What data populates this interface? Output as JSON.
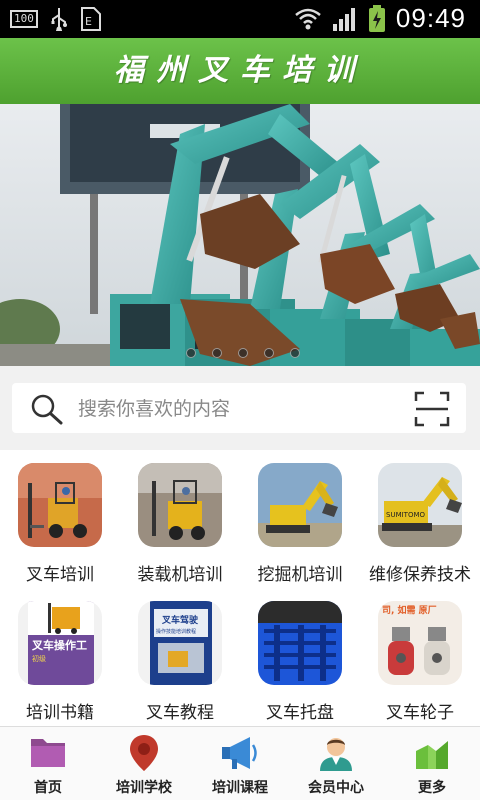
{
  "status_bar": {
    "battery_badge": "100",
    "time": "09:49"
  },
  "header": {
    "title": "福州叉车培训"
  },
  "banner": {
    "slide_count": 5
  },
  "search": {
    "placeholder": "搜索你喜欢的内容"
  },
  "categories": [
    {
      "label": "叉车培训"
    },
    {
      "label": "装载机培训"
    },
    {
      "label": "挖掘机培训"
    },
    {
      "label": "维修保养技术"
    },
    {
      "label": "培训书籍",
      "book_title": "叉车操作工",
      "book_text": "初级"
    },
    {
      "label": "叉车教程",
      "book_title": "叉车驾驶",
      "book_subtitle": "操作技能培训教程"
    },
    {
      "label": "叉车托盘"
    },
    {
      "label": "叉车轮子",
      "ad_text": "司, 如需  原厂"
    }
  ],
  "bottom_nav": [
    {
      "label": "首页",
      "icon": "folder-icon"
    },
    {
      "label": "培训学校",
      "icon": "location-pin-icon"
    },
    {
      "label": "培训课程",
      "icon": "megaphone-icon"
    },
    {
      "label": "会员中心",
      "icon": "user-icon"
    },
    {
      "label": "更多",
      "icon": "more-chart-icon"
    }
  ],
  "colors": {
    "header_green": "#5bb33a",
    "excavator_teal": "#3aaea8"
  }
}
